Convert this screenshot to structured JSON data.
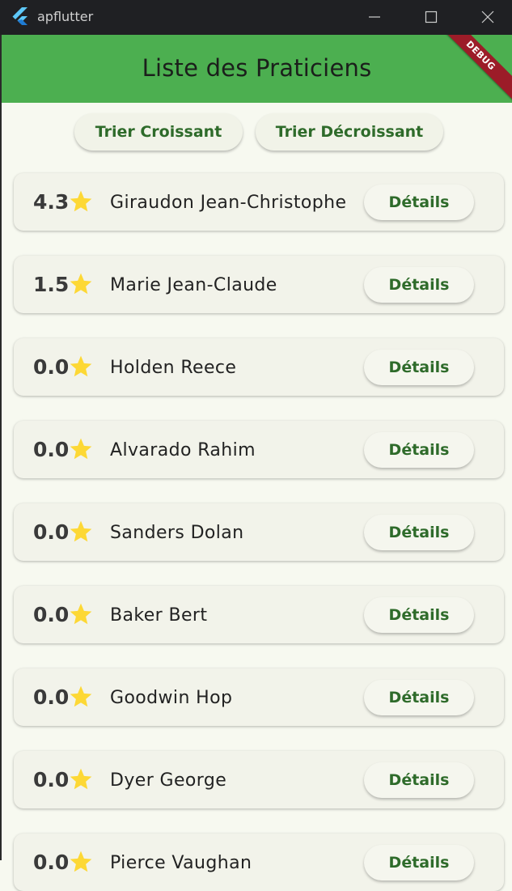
{
  "window": {
    "title": "apflutter"
  },
  "appbar": {
    "title": "Liste des Praticiens",
    "debug_label": "DEBUG",
    "color": "#4caf50"
  },
  "sort": {
    "ascending_label": "Trier Croissant",
    "descending_label": "Trier Décroissant"
  },
  "praticiens": [
    {
      "rating": "4.3",
      "name": "Giraudon Jean-Christophe",
      "button": "Détails"
    },
    {
      "rating": "1.5",
      "name": "Marie Jean-Claude",
      "button": "Détails"
    },
    {
      "rating": "0.0",
      "name": "Holden Reece",
      "button": "Détails"
    },
    {
      "rating": "0.0",
      "name": "Alvarado Rahim",
      "button": "Détails"
    },
    {
      "rating": "0.0",
      "name": "Sanders Dolan",
      "button": "Détails"
    },
    {
      "rating": "0.0",
      "name": "Baker Bert",
      "button": "Détails"
    },
    {
      "rating": "0.0",
      "name": "Goodwin Hop",
      "button": "Détails"
    },
    {
      "rating": "0.0",
      "name": "Dyer George",
      "button": "Détails"
    },
    {
      "rating": "0.0",
      "name": "Pierce Vaughan",
      "button": "Détails"
    }
  ],
  "colors": {
    "accent_text": "#2e6b2a",
    "star": "#fdd835",
    "debug_banner": "#9c1c28"
  },
  "icons": {
    "star": "star-icon",
    "logo": "flutter-logo-icon"
  }
}
